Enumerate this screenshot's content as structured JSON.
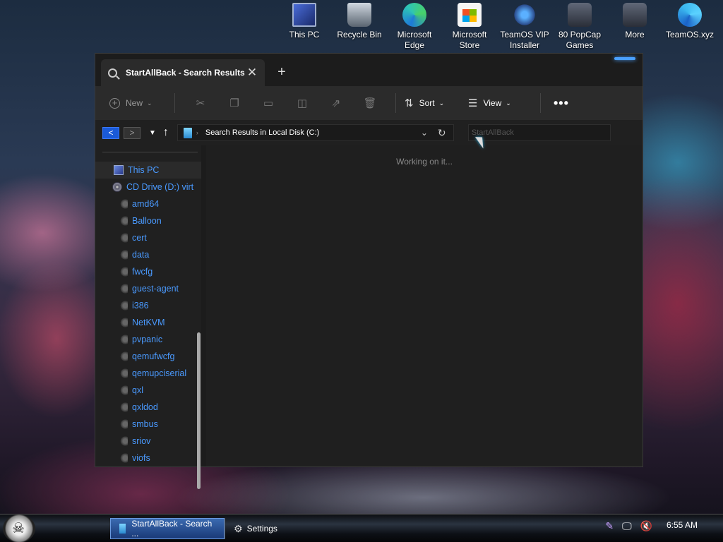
{
  "desktop": {
    "icons": [
      {
        "label": "This PC",
        "icon": "computer-icon"
      },
      {
        "label": "Recycle Bin",
        "icon": "recycle-bin-icon"
      },
      {
        "label": "Microsoft Edge",
        "icon": "edge-icon"
      },
      {
        "label": "Microsoft Store",
        "icon": "store-icon"
      },
      {
        "label": "TeamOS VIP Installer",
        "icon": "installer-icon"
      },
      {
        "label": "80 PopCap Games",
        "icon": "games-icon"
      },
      {
        "label": "More",
        "icon": "more-icon"
      },
      {
        "label": "TeamOS.xyz",
        "icon": "edge-icon"
      }
    ]
  },
  "explorer": {
    "tab_title": "StartAllBack - Search Results i",
    "close_glyph": "✕",
    "new_tab_glyph": "+",
    "toolbar": {
      "new_label": "New",
      "sort_label": "Sort",
      "view_label": "View",
      "more_label": "•••"
    },
    "address": {
      "path": "Search Results in Local Disk (C:)",
      "search_value": "StartAllBack"
    },
    "nav": {
      "this_pc": "This PC",
      "cd_drive": "CD Drive (D:) virt",
      "folders": [
        "amd64",
        "Balloon",
        "cert",
        "data",
        "fwcfg",
        "guest-agent",
        "i386",
        "NetKVM",
        "pvpanic",
        "qemufwcfg",
        "qemupciserial",
        "qxl",
        "qxldod",
        "smbus",
        "sriov",
        "viofs"
      ]
    },
    "status_text": "Working on it..."
  },
  "taskbar": {
    "tasks": [
      {
        "label": "StartAllBack - Search ..."
      },
      {
        "label": "Settings"
      }
    ],
    "clock": "6:55 AM"
  },
  "colors": {
    "accent": "#4a9aff",
    "window_bg": "#202020"
  }
}
